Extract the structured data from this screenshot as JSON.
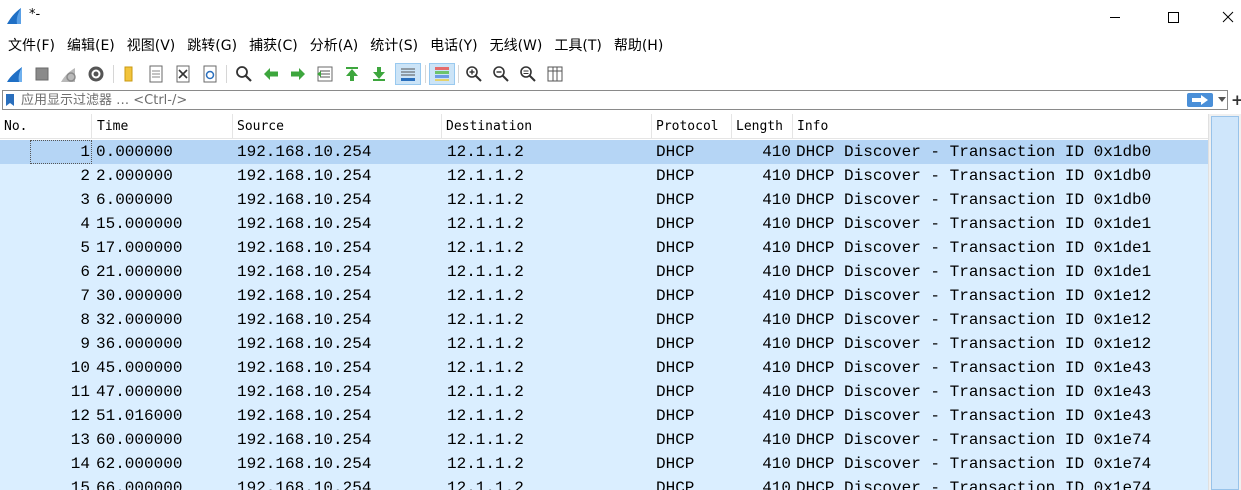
{
  "window": {
    "title": "*-",
    "minimize_glyph": "—",
    "maximize_glyph": "☐",
    "close_glyph": "✕"
  },
  "menu": [
    {
      "label": "文件(F)"
    },
    {
      "label": "编辑(E)"
    },
    {
      "label": "视图(V)"
    },
    {
      "label": "跳转(G)"
    },
    {
      "label": "捕获(C)"
    },
    {
      "label": "分析(A)"
    },
    {
      "label": "统计(S)"
    },
    {
      "label": "电话(Y)"
    },
    {
      "label": "无线(W)"
    },
    {
      "label": "工具(T)"
    },
    {
      "label": "帮助(H)"
    }
  ],
  "toolbar": {
    "icons": [
      "shark-fin-start-icon",
      "stop-square-icon",
      "restart-fin-icon",
      "capture-options-gear-icon",
      "open-folder-icon",
      "file-icon",
      "close-file-icon",
      "reload-icon",
      "find-magnifier-icon",
      "back-arrow-icon",
      "forward-arrow-icon",
      "go-to-packet-icon",
      "first-packet-icon",
      "last-packet-icon",
      "autoscroll-icon",
      "colorize-icon",
      "zoom-in-icon",
      "zoom-out-icon",
      "normal-size-icon",
      "resize-columns-icon"
    ]
  },
  "filter": {
    "placeholder": "应用显示过滤器 … <Ctrl-/>",
    "value": "",
    "plus": "+"
  },
  "columns": {
    "no": "No.",
    "time": "Time",
    "source": "Source",
    "destination": "Destination",
    "protocol": "Protocol",
    "length": "Length",
    "info": "Info"
  },
  "packets": [
    {
      "no": "1",
      "time": "0.000000",
      "source": "192.168.10.254",
      "destination": "12.1.1.2",
      "protocol": "DHCP",
      "length": "410",
      "info": "DHCP Discover - Transaction ID 0x1db0"
    },
    {
      "no": "2",
      "time": "2.000000",
      "source": "192.168.10.254",
      "destination": "12.1.1.2",
      "protocol": "DHCP",
      "length": "410",
      "info": "DHCP Discover - Transaction ID 0x1db0"
    },
    {
      "no": "3",
      "time": "6.000000",
      "source": "192.168.10.254",
      "destination": "12.1.1.2",
      "protocol": "DHCP",
      "length": "410",
      "info": "DHCP Discover - Transaction ID 0x1db0"
    },
    {
      "no": "4",
      "time": "15.000000",
      "source": "192.168.10.254",
      "destination": "12.1.1.2",
      "protocol": "DHCP",
      "length": "410",
      "info": "DHCP Discover - Transaction ID 0x1de1"
    },
    {
      "no": "5",
      "time": "17.000000",
      "source": "192.168.10.254",
      "destination": "12.1.1.2",
      "protocol": "DHCP",
      "length": "410",
      "info": "DHCP Discover - Transaction ID 0x1de1"
    },
    {
      "no": "6",
      "time": "21.000000",
      "source": "192.168.10.254",
      "destination": "12.1.1.2",
      "protocol": "DHCP",
      "length": "410",
      "info": "DHCP Discover - Transaction ID 0x1de1"
    },
    {
      "no": "7",
      "time": "30.000000",
      "source": "192.168.10.254",
      "destination": "12.1.1.2",
      "protocol": "DHCP",
      "length": "410",
      "info": "DHCP Discover - Transaction ID 0x1e12"
    },
    {
      "no": "8",
      "time": "32.000000",
      "source": "192.168.10.254",
      "destination": "12.1.1.2",
      "protocol": "DHCP",
      "length": "410",
      "info": "DHCP Discover - Transaction ID 0x1e12"
    },
    {
      "no": "9",
      "time": "36.000000",
      "source": "192.168.10.254",
      "destination": "12.1.1.2",
      "protocol": "DHCP",
      "length": "410",
      "info": "DHCP Discover - Transaction ID 0x1e12"
    },
    {
      "no": "10",
      "time": "45.000000",
      "source": "192.168.10.254",
      "destination": "12.1.1.2",
      "protocol": "DHCP",
      "length": "410",
      "info": "DHCP Discover - Transaction ID 0x1e43"
    },
    {
      "no": "11",
      "time": "47.000000",
      "source": "192.168.10.254",
      "destination": "12.1.1.2",
      "protocol": "DHCP",
      "length": "410",
      "info": "DHCP Discover - Transaction ID 0x1e43"
    },
    {
      "no": "12",
      "time": "51.016000",
      "source": "192.168.10.254",
      "destination": "12.1.1.2",
      "protocol": "DHCP",
      "length": "410",
      "info": "DHCP Discover - Transaction ID 0x1e43"
    },
    {
      "no": "13",
      "time": "60.000000",
      "source": "192.168.10.254",
      "destination": "12.1.1.2",
      "protocol": "DHCP",
      "length": "410",
      "info": "DHCP Discover - Transaction ID 0x1e74"
    },
    {
      "no": "14",
      "time": "62.000000",
      "source": "192.168.10.254",
      "destination": "12.1.1.2",
      "protocol": "DHCP",
      "length": "410",
      "info": "DHCP Discover - Transaction ID 0x1e74"
    },
    {
      "no": "15",
      "time": "66.000000",
      "source": "192.168.10.254",
      "destination": "12.1.1.2",
      "protocol": "DHCP",
      "length": "410",
      "info": "DHCP Discover - Transaction ID 0x1e74"
    }
  ],
  "selected_packet": "1",
  "colors": {
    "row_bg": "#daeeff",
    "selected_bg": "#b5d5f5",
    "accent": "#1f6fc5"
  }
}
